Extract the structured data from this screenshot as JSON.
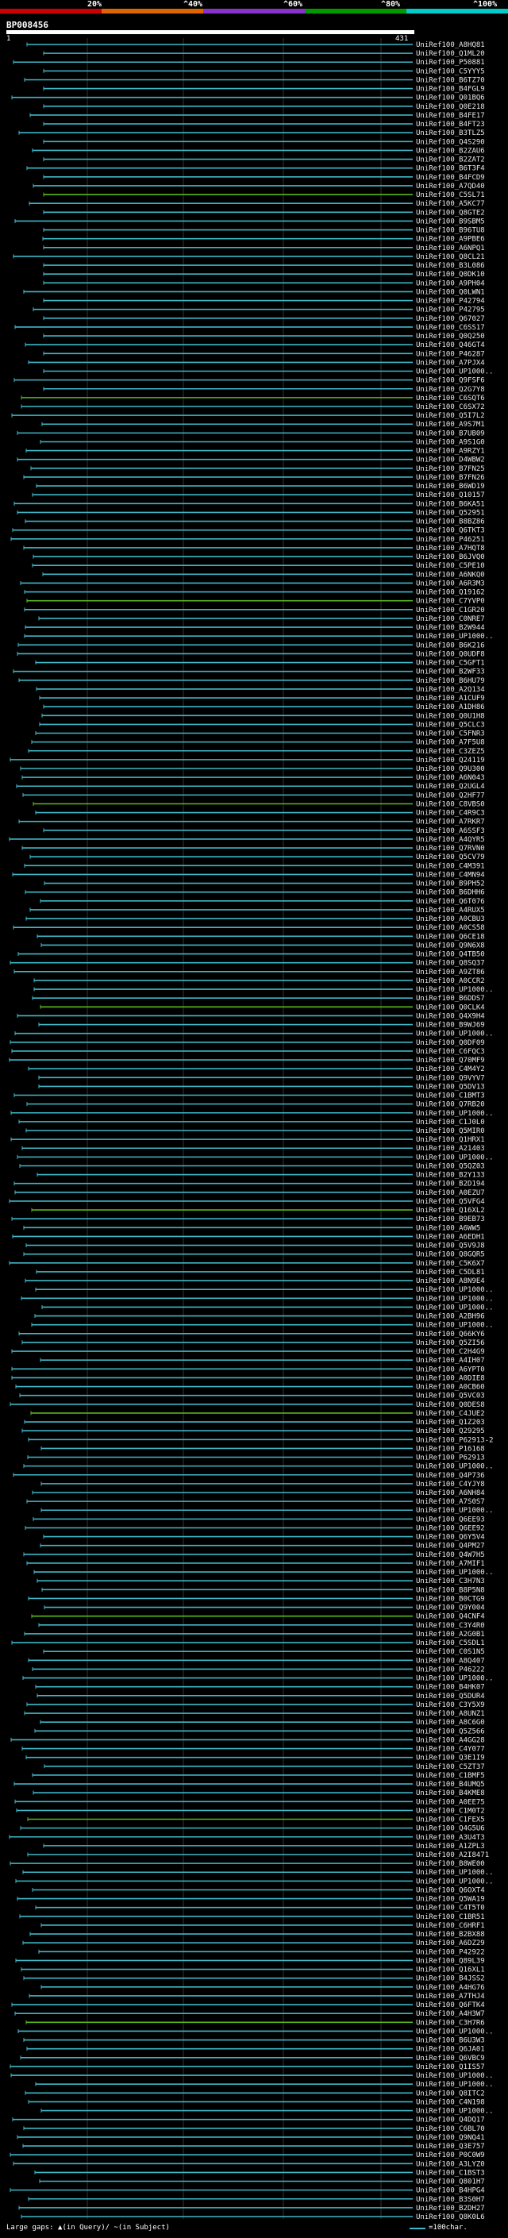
{
  "query_id": "BP008456",
  "ruler": {
    "start": "1",
    "end": "431"
  },
  "color_scale": {
    "labels": [
      "20%",
      "^40%",
      "^60%",
      "^80%",
      "^100%"
    ],
    "colors": [
      "#cc0000",
      "#dd6600",
      "#8833cc",
      "#009900",
      "#00cccc"
    ]
  },
  "legend": {
    "large_gaps": "Large gaps: ▲(in Query)/ ~(in Subject)",
    "scale_mark": "=100char."
  },
  "colors": {
    "cyan_hit": "#3fb8c8",
    "green_hit": "#59b81e",
    "query_bar": "#ffffff",
    "grid": "#333333"
  },
  "hits": [
    "UniRef100_A8HQ81",
    "UniRef100_Q1ML20",
    "UniRef100_P50881",
    "UniRef100_C5YYY5",
    "UniRef100_B6TZ70",
    "UniRef100_B4FGL9",
    "UniRef100_Q01BQ6",
    "UniRef100_Q0E218",
    "UniRef100_B4FE17",
    "UniRef100_B4FT23",
    "UniRef100_B3TLZ5",
    "UniRef100_Q4S290",
    "UniRef100_B2ZAU6",
    "UniRef100_B2ZAT2",
    "UniRef100_B6T3F4",
    "UniRef100_B4FCD9",
    "UniRef100_A7QD40",
    "UniRef100_C5SL71",
    "UniRef100_A5KC77",
    "UniRef100_Q8GTE2",
    "UniRef100_B9SBM5",
    "UniRef100_B96TU8",
    "UniRef100_A9PBE6",
    "UniRef100_A6NPQ1",
    "UniRef100_Q8CL21",
    "UniRef100_B3L086",
    "UniRef100_Q0DK10",
    "UniRef100_A9PH04",
    "UniRef100_Q0LWN1",
    "UniRef100_P42794",
    "UniRef100_P42795",
    "UniRef100_Q67027",
    "UniRef100_C6SS17",
    "UniRef100_Q0Q250",
    "UniRef100_Q46GT4",
    "UniRef100_P46287",
    "UniRef100_A7PJX4",
    "UniRef100_UP1000..",
    "UniRef100_Q9FSF6",
    "UniRef100_Q2G7Y8",
    "UniRef100_C6SQT6",
    "UniRef100_C6SX72",
    "UniRef100_Q5I7L2",
    "UniRef100_A9S7M1",
    "UniRef100_B7UB09",
    "UniRef100_A9S1G0",
    "UniRef100_A9RZY1",
    "UniRef100_D4WBW2",
    "UniRef100_B7FN25",
    "UniRef100_B7FN26",
    "UniRef100_B6WD19",
    "UniRef100_Q10157",
    "UniRef100_B6KA51",
    "UniRef100_Q52951",
    "UniRef100_B8BZ86",
    "UniRef100_Q6TKT3",
    "UniRef100_P46251",
    "UniRef100_A7HQT8",
    "UniRef100_B6JVQ0",
    "UniRef100_C5PE10",
    "UniRef100_A6NKQ0",
    "UniRef100_A6R3M3",
    "UniRef100_Q19162",
    "UniRef100_C7YVP0",
    "UniRef100_C1GR20",
    "UniRef100_C0NRE7",
    "UniRef100_B2W944",
    "UniRef100_UP1000..",
    "UniRef100_B6K216",
    "UniRef100_Q0UDF8",
    "UniRef100_C5GFT1",
    "UniRef100_B2WF33",
    "UniRef100_B6HU79",
    "UniRef100_A2Q134",
    "UniRef100_A1CUF9",
    "UniRef100_A1DH86",
    "UniRef100_Q0U1H8",
    "UniRef100_Q5CLC3",
    "UniRef100_C5FNR3",
    "UniRef100_A7F5U8",
    "UniRef100_C3ZEZ5",
    "UniRef100_Q24119",
    "UniRef100_Q9U300",
    "UniRef100_A6N043",
    "UniRef100_Q2UGL4",
    "UniRef100_Q2HF77",
    "UniRef100_C8VBS0",
    "UniRef100_C4R9C3",
    "UniRef100_A7RKR7",
    "UniRef100_A6SSF3",
    "UniRef100_A4QYR5",
    "UniRef100_Q7RVN0",
    "UniRef100_Q5CV79",
    "UniRef100_C4M391",
    "UniRef100_C4MN94",
    "UniRef100_B9PH52",
    "UniRef100_B6DHH6",
    "UniRef100_Q6T076",
    "UniRef100_A4RUX5",
    "UniRef100_A0CBU3",
    "UniRef100_A0CS58",
    "UniRef100_Q6CE18",
    "UniRef100_Q9N6X8",
    "UniRef100_Q4TB50",
    "UniRef100_Q8SQ37",
    "UniRef100_A9ZT86",
    "UniRef100_A0CCR2",
    "UniRef100_UP1000..",
    "UniRef100_B6DDS7",
    "UniRef100_Q0CLK4",
    "UniRef100_Q4X9H4",
    "UniRef100_B9WJ69",
    "UniRef100_UP1000..",
    "UniRef100_Q0DF09",
    "UniRef100_C6FQC3",
    "UniRef100_Q70MF9",
    "UniRef100_C4M4Y2",
    "UniRef100_Q9VYV7",
    "UniRef100_Q5DV13",
    "UniRef100_C1BMT3",
    "UniRef100_Q7RB20",
    "UniRef100_UP1000..",
    "UniRef100_C1J0L0",
    "UniRef100_Q5MIR0",
    "UniRef100_Q1HRX1",
    "UniRef100_A21403",
    "UniRef100_UP1000..",
    "UniRef100_Q5QZ03",
    "UniRef100_B2Y133",
    "UniRef100_B2D194",
    "UniRef100_A0EZU7",
    "UniRef100_Q5VFG4",
    "UniRef100_Q16XL2",
    "UniRef100_B9EB73",
    "UniRef100_A6WW5",
    "UniRef100_A6EDH1",
    "UniRef100_Q5V9J8",
    "UniRef100_Q8GQR5",
    "UniRef100_C5K6X7",
    "UniRef100_C5DL81",
    "UniRef100_A8N9E4",
    "UniRef100_UP1000..",
    "UniRef100_UP1000..",
    "UniRef100_UP1000..",
    "UniRef100_A2BH96",
    "UniRef100_UP1000..",
    "UniRef100_Q66KY6",
    "UniRef100_Q5ZI56",
    "UniRef100_C2H4G9",
    "UniRef100_A4IH07",
    "UniRef100_A6YPT0",
    "UniRef100_A0DIE8",
    "UniRef100_A0CB60",
    "UniRef100_Q5VC03",
    "UniRef100_Q0DES8",
    "UniRef100_C4JUE2",
    "UniRef100_Q1Z203",
    "UniRef100_Q29295",
    "UniRef100_P62913-2",
    "UniRef100_P16168",
    "UniRef100_P62913",
    "UniRef100_UP1000..",
    "UniRef100_Q4P736",
    "UniRef100_C4YJY8",
    "UniRef100_A6NH84",
    "UniRef100_A7S0S7",
    "UniRef100_UP1000..",
    "UniRef100_Q6EE93",
    "UniRef100_Q6EE92",
    "UniRef100_Q6Y5V4",
    "UniRef100_Q4PM27",
    "UniRef100_Q4W7H5",
    "UniRef100_A7MIF1",
    "UniRef100_UP1000..",
    "UniRef100_C3H7N3",
    "UniRef100_B8P5N8",
    "UniRef100_B0CTG9",
    "UniRef100_Q9Y004",
    "UniRef100_Q4CNF4",
    "UniRef100_C3Y4R0",
    "UniRef100_A2G0B1",
    "UniRef100_C5SDL1",
    "UniRef100_C0S1N5",
    "UniRef100_A8Q407",
    "UniRef100_P46222",
    "UniRef100_UP1000..",
    "UniRef100_B4HK07",
    "UniRef100_Q5DUR4",
    "UniRef100_C3Y5X9",
    "UniRef100_A8UNZ1",
    "UniRef100_A8C6G0",
    "UniRef100_Q5Z566",
    "UniRef100_A4GG28",
    "UniRef100_C4Y077",
    "UniRef100_Q3E1I9",
    "UniRef100_C5ZT37",
    "UniRef100_C1BMF5",
    "UniRef100_B4UMQ5",
    "UniRef100_B4KME8",
    "UniRef100_A0EE75",
    "UniRef100_C1M0T2",
    "UniRef100_C1FEX5",
    "UniRef100_Q4G5U6",
    "UniRef100_A3U4T3",
    "UniRef100_A1ZPL3",
    "UniRef100_A2I8471",
    "UniRef100_B8WE00",
    "UniRef100_UP1000..",
    "UniRef100_UP1000..",
    "UniRef100_Q6OXT4",
    "UniRef100_Q5WA19",
    "UniRef100_C4T5T0",
    "UniRef100_C1BR51",
    "UniRef100_C6HRF1",
    "UniRef100_B2BX88",
    "UniRef100_A6DZ29",
    "UniRef100_P42922",
    "UniRef100_Q89L39",
    "UniRef100_Q16XL1",
    "UniRef100_B4JSS2",
    "UniRef100_A4HG76",
    "UniRef100_A7THJ4",
    "UniRef100_Q6FTK4",
    "UniRef100_A4H3W7",
    "UniRef100_C3H7R6",
    "UniRef100_UP1000..",
    "UniRef100_B6U3W3",
    "UniRef100_Q6JA01",
    "UniRef100_Q6VBC9",
    "UniRef100_Q1IS57",
    "UniRef100_UP1000..",
    "UniRef100_UP1000..",
    "UniRef100_Q8ITC2",
    "UniRef100_C4N198",
    "UniRef100_UP1000..",
    "UniRef100_Q4DQ17",
    "UniRef100_C6BL70",
    "UniRef100_Q9NQ41",
    "UniRef100_Q3E757",
    "UniRef100_P0C0W9",
    "UniRef100_A3LYZ0",
    "UniRef100_C1BST3",
    "UniRef100_Q801H7",
    "UniRef100_B4HPG4",
    "UniRef100_B3S0H7",
    "UniRef100_B2DH27",
    "UniRef100_Q8K0L6"
  ]
}
